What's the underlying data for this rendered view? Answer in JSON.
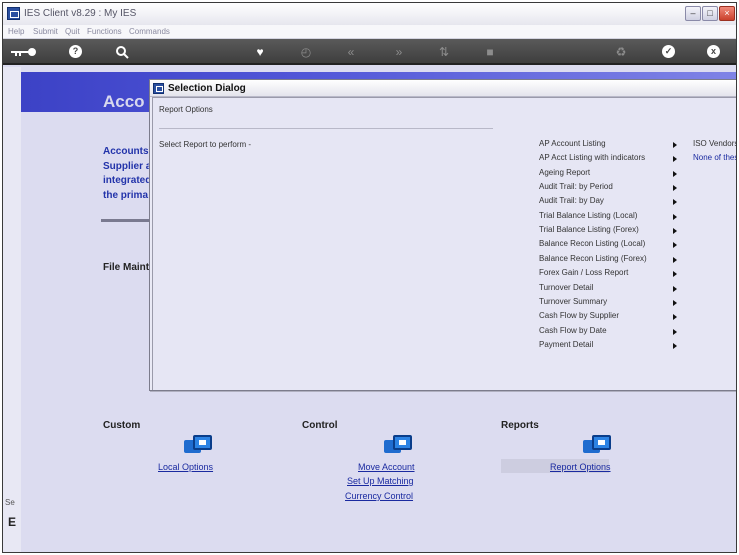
{
  "window": {
    "title": "IES Client v8.29 : My IES"
  },
  "menu": [
    "Help",
    "Submit",
    "Quit",
    "Functions",
    "Commands"
  ],
  "toolbar": {
    "icons": [
      "key-icon",
      "help-icon",
      "search-icon",
      "heart-icon",
      "clock-icon",
      "rewind-icon",
      "fast-forward-icon",
      "sort-icon",
      "stop-icon",
      "recycle-icon",
      "check-icon",
      "close-icon"
    ],
    "help_glyph": "?",
    "check_glyph": "✓",
    "close_glyph": "x"
  },
  "main": {
    "banner_title": "Acco",
    "intro_lines": [
      "Accounts",
      "Supplier a",
      "integrated",
      "the prima"
    ],
    "file_maint": "File Maint",
    "sections": {
      "custom": {
        "title": "Custom",
        "links": [
          "Local Options"
        ]
      },
      "control": {
        "title": "Control",
        "links": [
          "Move Account",
          "Set Up Matching",
          "Currency Control"
        ]
      },
      "reports": {
        "title": "Reports",
        "links": [
          "Report Options"
        ]
      }
    }
  },
  "leftstrip": {
    "label": "Se",
    "letter": "E"
  },
  "dialog": {
    "title": "Selection Dialog",
    "subtitle": "Report Options",
    "prompt": "Select Report to perform -",
    "reports": [
      "AP Account Listing",
      "AP Acct Listing with indicators",
      "Ageing Report",
      "Audit Trail: by Period",
      "Audit Trail: by Day",
      "Trial Balance Listing (Local)",
      "Trial Balance Listing (Forex)",
      "Balance Recon Listing (Local)",
      "Balance Recon Listing (Forex)",
      "Forex Gain / Loss Report",
      "Turnover Detail",
      "Turnover Summary",
      "Cash Flow by Supplier",
      "Cash Flow by Date",
      "Payment Detail"
    ],
    "submenu": [
      "ISO Vendors A",
      "None of these"
    ]
  },
  "colors": {
    "banner": "#4a4fd0",
    "link": "#1a2aa0",
    "submenu_highlight": "#1a2aa0"
  }
}
